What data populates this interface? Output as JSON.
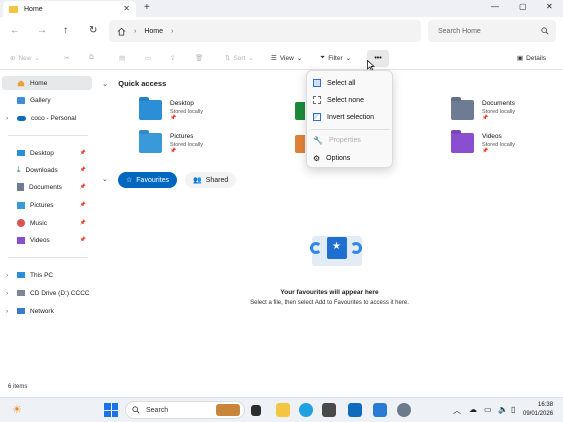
{
  "window": {
    "tab_title": "Home",
    "tab_close": "✕",
    "new_tab": "+",
    "controls": [
      "—",
      "▢",
      "✕"
    ]
  },
  "navbar": {
    "breadcrumb": "Home",
    "search_placeholder": "Search Home"
  },
  "toolbar": {
    "new_label": "New",
    "sort_label": "Sort",
    "view_label": "View",
    "filter_label": "Filter",
    "more_label": "•••",
    "details_label": "Details"
  },
  "sidebar": {
    "items": [
      {
        "label": "Home",
        "icon": "home-icon",
        "active": true
      },
      {
        "label": "Gallery",
        "icon": "gallery-icon"
      },
      {
        "label": "coco - Personal",
        "icon": "cloud-icon"
      },
      {
        "label": "Desktop",
        "icon": "desktop-icon",
        "pinned": true
      },
      {
        "label": "Downloads",
        "icon": "downloads-icon",
        "pinned": true
      },
      {
        "label": "Documents",
        "icon": "documents-icon",
        "pinned": true
      },
      {
        "label": "Pictures",
        "icon": "pictures-icon",
        "pinned": true
      },
      {
        "label": "Music",
        "icon": "music-icon",
        "pinned": true
      },
      {
        "label": "Videos",
        "icon": "videos-icon",
        "pinned": true
      },
      {
        "label": "This PC",
        "icon": "this-pc-icon"
      },
      {
        "label": "CD Drive (D:) CCCC",
        "icon": "cd-drive-icon"
      },
      {
        "label": "Network",
        "icon": "network-icon"
      }
    ]
  },
  "quick_access": {
    "title": "Quick access",
    "items": [
      {
        "name": "Desktop",
        "sub": "Stored locally",
        "color": "#2a8fd6"
      },
      {
        "name": "Pictures",
        "sub": "Stored locally",
        "color": "#3a9ad9"
      },
      {
        "name": "Documents",
        "sub": "Stored locally",
        "color": "#6d7c93"
      },
      {
        "name": "Videos",
        "sub": "Stored locally",
        "color": "#8a4fd0"
      }
    ],
    "pin_glyph": "📌"
  },
  "favourites": {
    "tab_favourites": "Favourites",
    "tab_shared": "Shared",
    "empty_title": "Your favourites will appear here",
    "empty_sub": "Select a file, then select Add to Favourites to access it here."
  },
  "context_menu": {
    "items": [
      {
        "label": "Select all",
        "enabled": true
      },
      {
        "label": "Select none",
        "enabled": true
      },
      {
        "label": "Invert selection",
        "enabled": true
      },
      {
        "label": "Properties",
        "enabled": false
      },
      {
        "label": "Options",
        "enabled": true
      }
    ]
  },
  "status_bar": {
    "item_count": "6 items"
  },
  "taskbar": {
    "search_label": "Search",
    "time": "16:38",
    "date": "09/01/2026"
  },
  "colors": {
    "accent": "#0067c0",
    "folder_yellow": "#f4c542"
  }
}
